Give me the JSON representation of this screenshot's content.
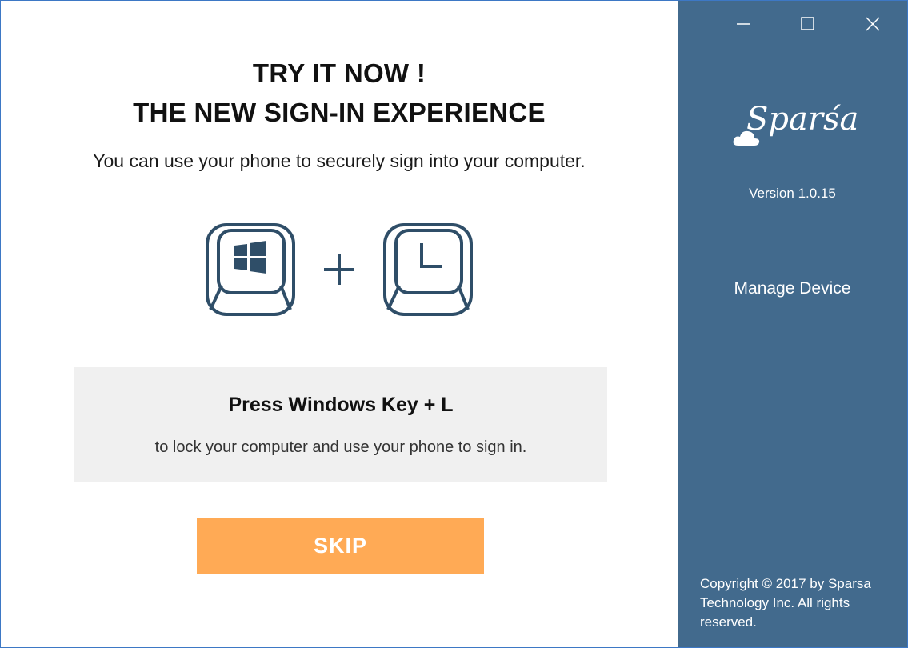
{
  "main": {
    "headline_line1": "TRY IT NOW !",
    "headline_line2": "THE NEW SIGN-IN EXPERIENCE",
    "subtitle": "You can use your phone to securely sign into your computer.",
    "keys": {
      "first_key_icon": "windows-logo-icon",
      "plus_icon": "plus-icon",
      "second_key_letter": "L"
    },
    "info": {
      "title": "Press Windows Key + L",
      "text": "to lock your computer and use your phone to sign in."
    },
    "skip_label": "SKIP"
  },
  "sidebar": {
    "window_controls": [
      "minimize-icon",
      "maximize-icon",
      "close-icon"
    ],
    "logo_text": "Sparśa",
    "version": "Version 1.0.15",
    "manage_device_label": "Manage Device",
    "copyright": "Copyright © 2017 by Sparsa Technology Inc. All rights reserved."
  },
  "colors": {
    "sidebar_bg": "#426a8d",
    "key_stroke": "#2f4e68",
    "skip_bg": "#ffaa55",
    "info_bg": "#f0f0f0",
    "window_border": "#3d78c5"
  }
}
